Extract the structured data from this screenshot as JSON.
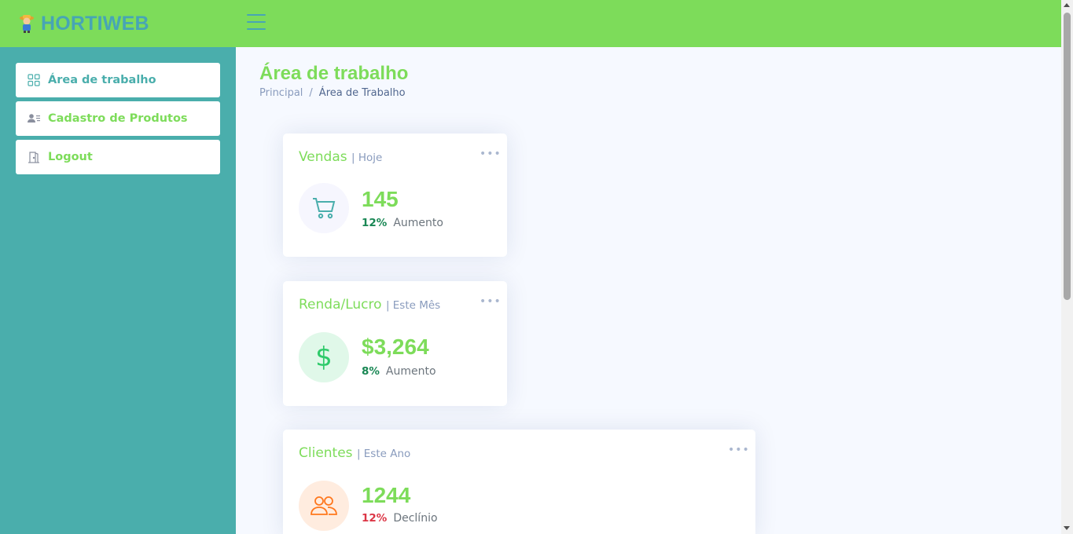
{
  "header": {
    "brand": "HORTIWEB",
    "logo_icon": "farmer-icon",
    "menu_icon": "hamburger-icon",
    "colors": {
      "background": "#7ddc5a",
      "brand_text": "#47a5b5"
    }
  },
  "sidebar": {
    "background": "#4aaeac",
    "items": [
      {
        "label": "Área de trabalho",
        "icon": "grid-icon",
        "active": true
      },
      {
        "label": "Cadastro de Produtos",
        "icon": "person-list-icon",
        "active": false
      },
      {
        "label": "Logout",
        "icon": "door-icon",
        "active": false
      }
    ]
  },
  "main": {
    "title": "Área de trabalho",
    "breadcrumb": [
      "Principal",
      "Área de Trabalho"
    ],
    "breadcrumb_separator": "/",
    "cards": [
      {
        "title": "Vendas",
        "period": "| Hoje",
        "value": "145",
        "change_pct": "12%",
        "change_word": "Aumento",
        "change_color": "#198754",
        "icon": "cart-icon",
        "icon_bg": "#f6f6fe",
        "icon_color": "#4aaeac",
        "menu": "•••"
      },
      {
        "title": "Renda/Lucro",
        "period": "| Este Mês",
        "value": "$3,264",
        "change_pct": "8%",
        "change_word": "Aumento",
        "change_color": "#198754",
        "icon": "dollar-icon",
        "icon_bg": "#e0f8e9",
        "icon_color": "#2eca6a",
        "menu": "•••"
      },
      {
        "title": "Clientes",
        "period": "| Este Ano",
        "value": "1244",
        "change_pct": "12%",
        "change_word": "Declínio",
        "change_color": "#dc3545",
        "icon": "people-icon",
        "icon_bg": "#ffecdf",
        "icon_color": "#ff771d",
        "menu": "•••"
      }
    ]
  }
}
